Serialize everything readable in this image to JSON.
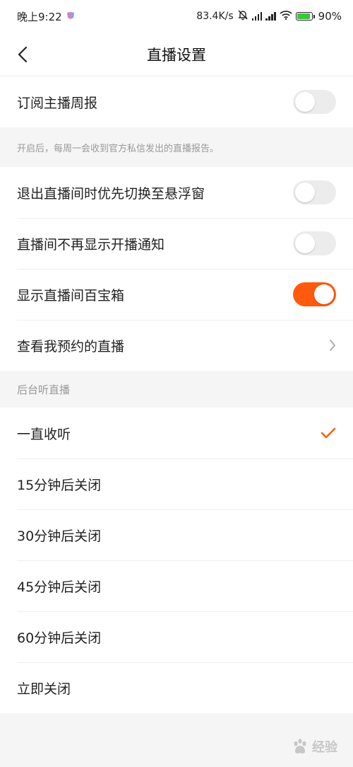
{
  "status_bar": {
    "time": "晚上9:22",
    "net_speed": "83.4K/s",
    "battery_pct": "90%",
    "battery_level": 0.9,
    "icons": [
      "app-notification-icon",
      "mute-bell-icon",
      "signal-icon",
      "signal-icon",
      "wifi-icon",
      "battery-charging-icon"
    ]
  },
  "nav": {
    "title": "直播设置",
    "back_icon": "chevron-left-icon"
  },
  "settings": {
    "subscribe_weekly": {
      "label": "订阅主播周报",
      "on": false
    },
    "subscribe_hint": "开启后，每周一会收到官方私信发出的直播报告。",
    "float_window": {
      "label": "退出直播间时优先切换至悬浮窗",
      "on": false
    },
    "no_start_notice": {
      "label": "直播间不再显示开播通知",
      "on": false
    },
    "treasure_box": {
      "label": "显示直播间百宝箱",
      "on": true
    },
    "my_reservations": {
      "label": "查看我预约的直播",
      "icon": "chevron-right-icon"
    }
  },
  "background_listen": {
    "header": "后台听直播",
    "options": [
      {
        "label": "一直收听",
        "selected": true
      },
      {
        "label": "15分钟后关闭",
        "selected": false
      },
      {
        "label": "30分钟后关闭",
        "selected": false
      },
      {
        "label": "45分钟后关闭",
        "selected": false
      },
      {
        "label": "60分钟后关闭",
        "selected": false
      },
      {
        "label": "立即关闭",
        "selected": false
      }
    ]
  },
  "colors": {
    "accent": "#ff5a0e",
    "toggle_off": "#ececec",
    "background": "#f5f5f5",
    "hint_text": "#999999"
  },
  "watermark": {
    "text": "经验",
    "logo": "baidu-paw-logo"
  }
}
